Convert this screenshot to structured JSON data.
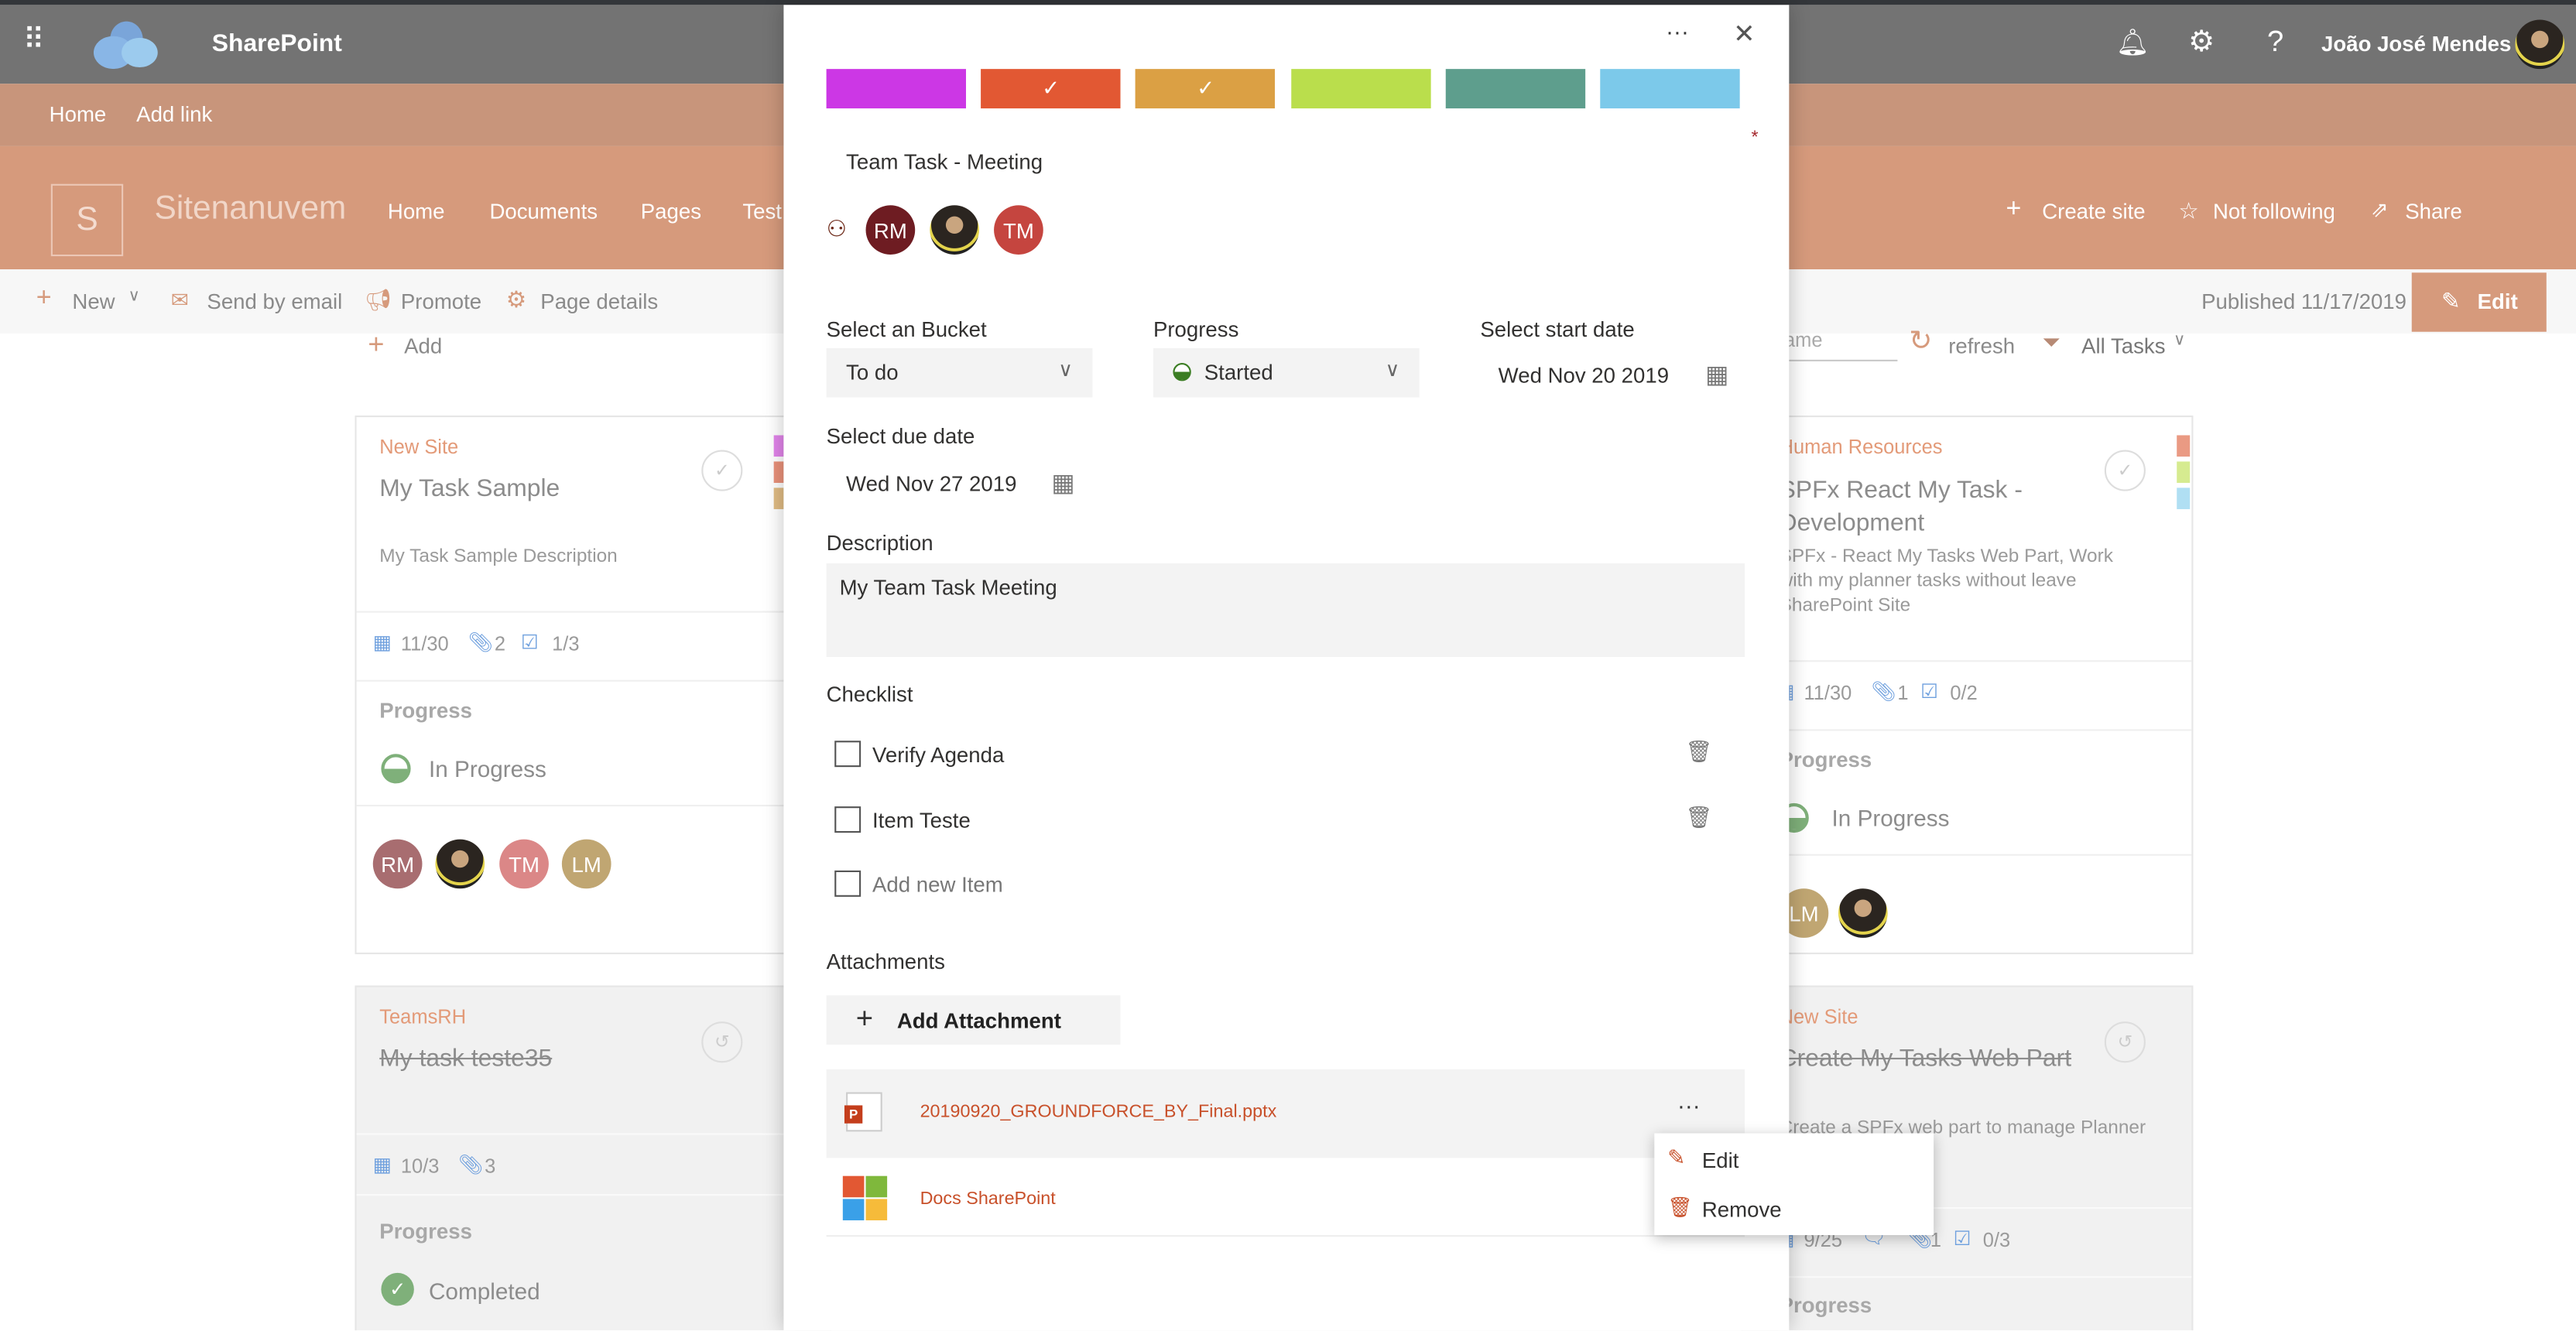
{
  "suite_bar": {
    "app_name": "SharePoint",
    "user_name": "João José Mendes",
    "icons": [
      "waffle-icon",
      "onedrive-cloud-logo",
      "bell-icon",
      "gear-icon",
      "help-icon"
    ]
  },
  "top_nav": {
    "items": [
      "Home",
      "Add link"
    ]
  },
  "site_header": {
    "logo_letter": "S",
    "site_name": "Sitenanuvem",
    "nav": [
      "Home",
      "Documents",
      "Pages",
      "Test"
    ],
    "actions": {
      "create_site": "Create site",
      "follow": "Not following",
      "share": "Share"
    }
  },
  "command_bar": {
    "new": "New",
    "send_email": "Send by email",
    "promote": "Promote",
    "page_details": "Page details",
    "published": "Published 11/17/2019",
    "edit": "Edit"
  },
  "board": {
    "add": "Add",
    "search_placeholder_partial": "ame",
    "refresh": "refresh",
    "filter": "All Tasks"
  },
  "cards": [
    {
      "site": "New Site",
      "title": "My Task Sample",
      "description": "My Task Sample Description",
      "due": "11/30",
      "attachments": "2",
      "checklist": "1/3",
      "progress_label": "Progress",
      "progress": "In Progress",
      "assignees": [
        "RM",
        "",
        "TM",
        "LM"
      ],
      "labels": [
        "#e184ea",
        "#e9917a",
        "#e0bc84"
      ]
    },
    {
      "site": "TeamsRH",
      "title": "My task teste35",
      "completed": true,
      "due": "10/3",
      "attachments": "3",
      "progress_label": "Progress",
      "progress": "Completed"
    },
    {
      "site": "Human Resources",
      "title": "SPFx React My Task - Development",
      "description": "SPFx - React My Tasks Web Part, Work with my planner tasks without leave SharePoint Site",
      "due": "11/30",
      "attachments": "1",
      "checklist": "0/2",
      "progress_label": "Progress",
      "progress": "In Progress",
      "assignees": [
        "LM",
        ""
      ],
      "labels": [
        "#ea9a83",
        "#d6eb90",
        "#b0dff3"
      ]
    },
    {
      "site": "New Site",
      "title": "Create My Tasks Web Part",
      "completed": true,
      "description": "Create a SPFx web part to manage Planner",
      "due": "9/25",
      "attachments": "1",
      "checklist": "0/3",
      "progress_label": "Progress"
    }
  ],
  "panel": {
    "more": "···",
    "close": "✕",
    "label_colors": [
      {
        "color": "#cc37e5",
        "selected": false
      },
      {
        "color": "#e25833",
        "selected": true
      },
      {
        "color": "#dba044",
        "selected": true
      },
      {
        "color": "#bade4c",
        "selected": false
      },
      {
        "color": "#5e9e8d",
        "selected": false
      },
      {
        "color": "#7cc9ea",
        "selected": false
      }
    ],
    "required_mark": "*",
    "title": "Team Task - Meeting",
    "assignees": [
      "RM",
      "",
      "TM"
    ],
    "bucket": {
      "label": "Select an Bucket",
      "value": "To do"
    },
    "progress": {
      "label": "Progress",
      "value": "Started"
    },
    "start_date": {
      "label": "Select start date",
      "value": "Wed Nov 20 2019"
    },
    "due_date": {
      "label": "Select due date",
      "value": "Wed Nov 27 2019"
    },
    "description": {
      "label": "Description",
      "value": "My Team Task Meeting"
    },
    "checklist": {
      "label": "Checklist",
      "items": [
        "Verify Agenda",
        "Item Teste"
      ],
      "add_placeholder": "Add new Item"
    },
    "attachments": {
      "label": "Attachments",
      "add_button": "Add Attachment",
      "items": [
        {
          "name": "20190920_GROUNDFORCE_BY_Final.pptx",
          "type": "powerpoint"
        },
        {
          "name": "Docs SharePoint",
          "type": "link"
        }
      ],
      "more": "···"
    },
    "context_menu": {
      "edit": "Edit",
      "remove": "Remove"
    }
  },
  "colors": {
    "accent": "#d69a7c",
    "link": "#c8502a",
    "suite_bar": "#737373"
  }
}
